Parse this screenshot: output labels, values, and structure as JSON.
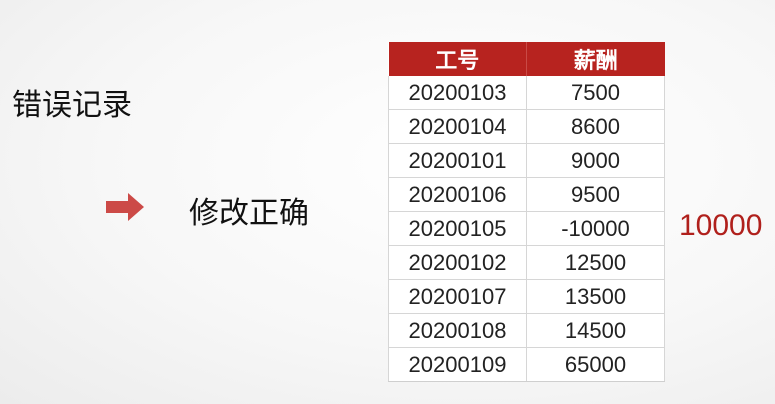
{
  "labels": {
    "error_record": "错误记录",
    "correction": "修改正确",
    "corrected_value": "10000"
  },
  "colors": {
    "header_bg": "#b7231f",
    "arrow": "#cc4a47",
    "corrected_text": "#b0201c"
  },
  "icons": {
    "arrow": "right-arrow-icon"
  },
  "table": {
    "headers": [
      "工号",
      "薪酬"
    ],
    "rows": [
      [
        "20200103",
        "7500"
      ],
      [
        "20200104",
        "8600"
      ],
      [
        "20200101",
        "9000"
      ],
      [
        "20200106",
        "9500"
      ],
      [
        "20200105",
        "-10000"
      ],
      [
        "20200102",
        "12500"
      ],
      [
        "20200107",
        "13500"
      ],
      [
        "20200108",
        "14500"
      ],
      [
        "20200109",
        "65000"
      ]
    ]
  }
}
